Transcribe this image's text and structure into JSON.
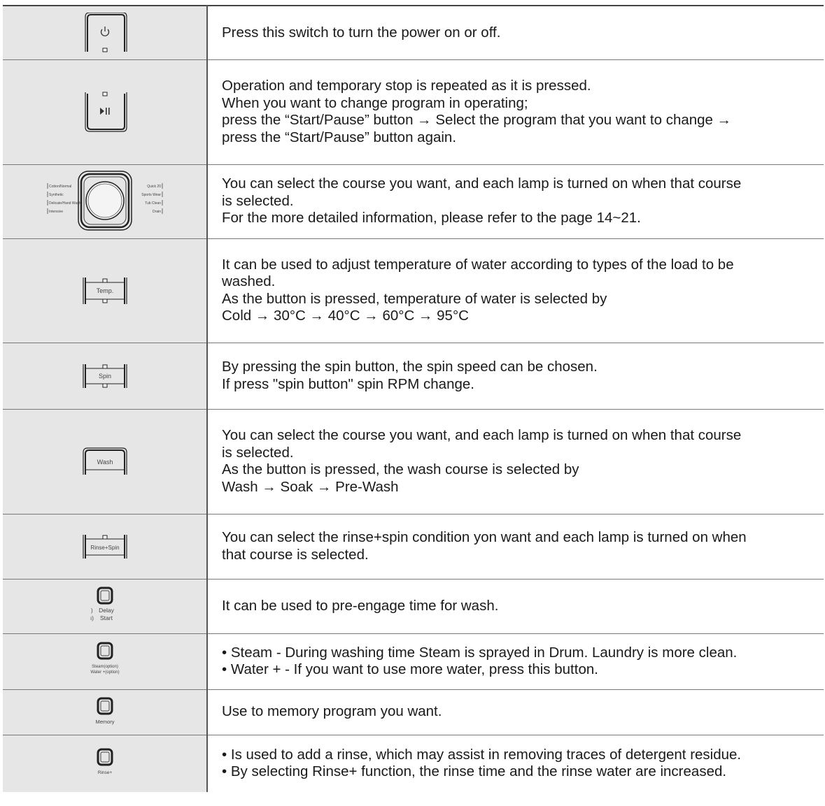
{
  "rows": [
    {
      "icon_name": "power-button-icon",
      "icon_label": "",
      "lines": [
        "Press this switch to turn the power on or off."
      ]
    },
    {
      "icon_name": "start-pause-button-icon",
      "icon_label": "",
      "lines": [
        "Operation and temporary stop is repeated as it is pressed.",
        "When you want to change program in operating;",
        "press the “Start/Pause” button → Select the program that you want to change →",
        "press the “Start/Pause” button again."
      ]
    },
    {
      "icon_name": "course-dial-icon",
      "icon_label": "",
      "dial_left_labels": [
        "Cotton/Normal",
        "Synthetic",
        "Delicate/Hand Wash",
        "Intensive"
      ],
      "dial_right_labels": [
        "Quick 20",
        "Sports Wear",
        "Tub Clean",
        "Drain"
      ],
      "lines": [
        "You can select the course you want, and each lamp is turned on when that course",
        "is selected.",
        "For the more detailed information, please refer to the page 14~21."
      ]
    },
    {
      "icon_name": "temp-button-icon",
      "icon_label": "Temp.",
      "lines": [
        "It can be used to adjust temperature of water according to types of the load to be",
        "washed.",
        "As the button is pressed, temperature of water is selected by",
        "Cold → 30°C → 40°C → 60°C → 95°C"
      ]
    },
    {
      "icon_name": "spin-button-icon",
      "icon_label": "Spin",
      "lines": [
        "By pressing the spin button, the spin speed can be chosen.",
        "If press \"spin button\" spin RPM change."
      ]
    },
    {
      "icon_name": "wash-button-icon",
      "icon_label": "Wash",
      "lines": [
        "You can select the course you want, and each lamp is turned on when that course",
        "is selected.",
        "As the button is pressed, the wash course is selected by",
        "Wash → Soak → Pre-Wash"
      ]
    },
    {
      "icon_name": "rinse-spin-button-icon",
      "icon_label": "Rinse+Spin",
      "lines": [
        "You can select the rinse+spin condition yon want and each lamp is turned on when",
        "that course is selected."
      ]
    },
    {
      "icon_name": "delay-start-button-icon",
      "icon_label": "Delay Start",
      "icon_label_lines": [
        "Delay",
        "Start"
      ],
      "lines": [
        "It can be used to pre-engage time for wash."
      ]
    },
    {
      "icon_name": "steam-water-button-icon",
      "icon_label": "Steam(option) Water +(option)",
      "icon_label_lines": [
        "Steam(option)",
        "Water +(option)"
      ],
      "lines": [
        "• Steam - During washing time Steam is sprayed in Drum. Laundry is more clean.",
        "• Water + - If you want to use more water, press this button."
      ]
    },
    {
      "icon_name": "memory-button-icon",
      "icon_label": "Memory",
      "lines": [
        "Use to memory program you want."
      ]
    },
    {
      "icon_name": "rinse-plus-button-icon",
      "icon_label": "Rinse+",
      "lines": [
        "• Is used to add a rinse, which may assist in removing traces of detergent residue.",
        "• By selecting Rinse+ function, the rinse time and the rinse water are increased."
      ]
    }
  ]
}
